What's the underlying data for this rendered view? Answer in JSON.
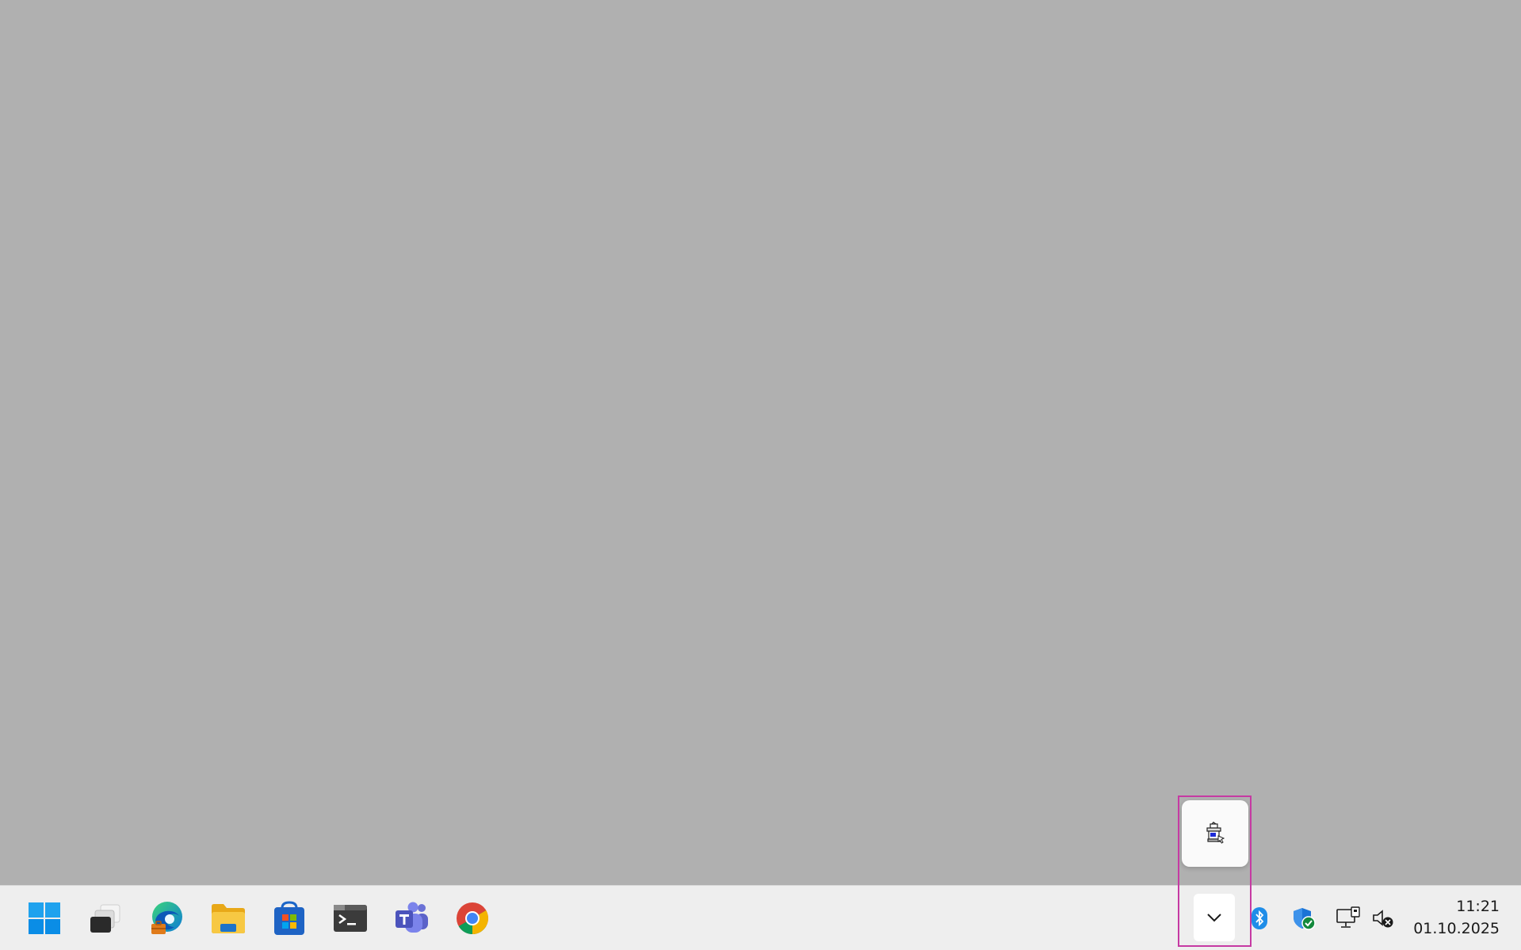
{
  "desktop": {
    "background": "#b0b0b0"
  },
  "taskbar": {
    "pinned_apps": [
      {
        "name": "Start",
        "icon": "windows-logo-icon"
      },
      {
        "name": "Task View",
        "icon": "task-view-icon"
      },
      {
        "name": "Microsoft Edge",
        "icon": "edge-icon"
      },
      {
        "name": "File Explorer",
        "icon": "folder-icon"
      },
      {
        "name": "Microsoft Store",
        "icon": "store-icon"
      },
      {
        "name": "Terminal",
        "icon": "terminal-icon"
      },
      {
        "name": "Microsoft Teams",
        "icon": "teams-icon"
      },
      {
        "name": "Google Chrome",
        "icon": "chrome-icon"
      }
    ],
    "tray": {
      "overflow_button_icon": "chevron-down-icon",
      "icons": [
        "bluetooth-icon",
        "windows-security-icon",
        "network-icon",
        "volume-muted-icon"
      ],
      "time": "11:21",
      "date": "01.10.2025"
    }
  },
  "overflow_popup": {
    "icons": [
      "printer-app-icon"
    ]
  },
  "colors": {
    "highlight": "#c63aa3",
    "taskbar": "#eeeeee",
    "accent": "#0078d4"
  }
}
